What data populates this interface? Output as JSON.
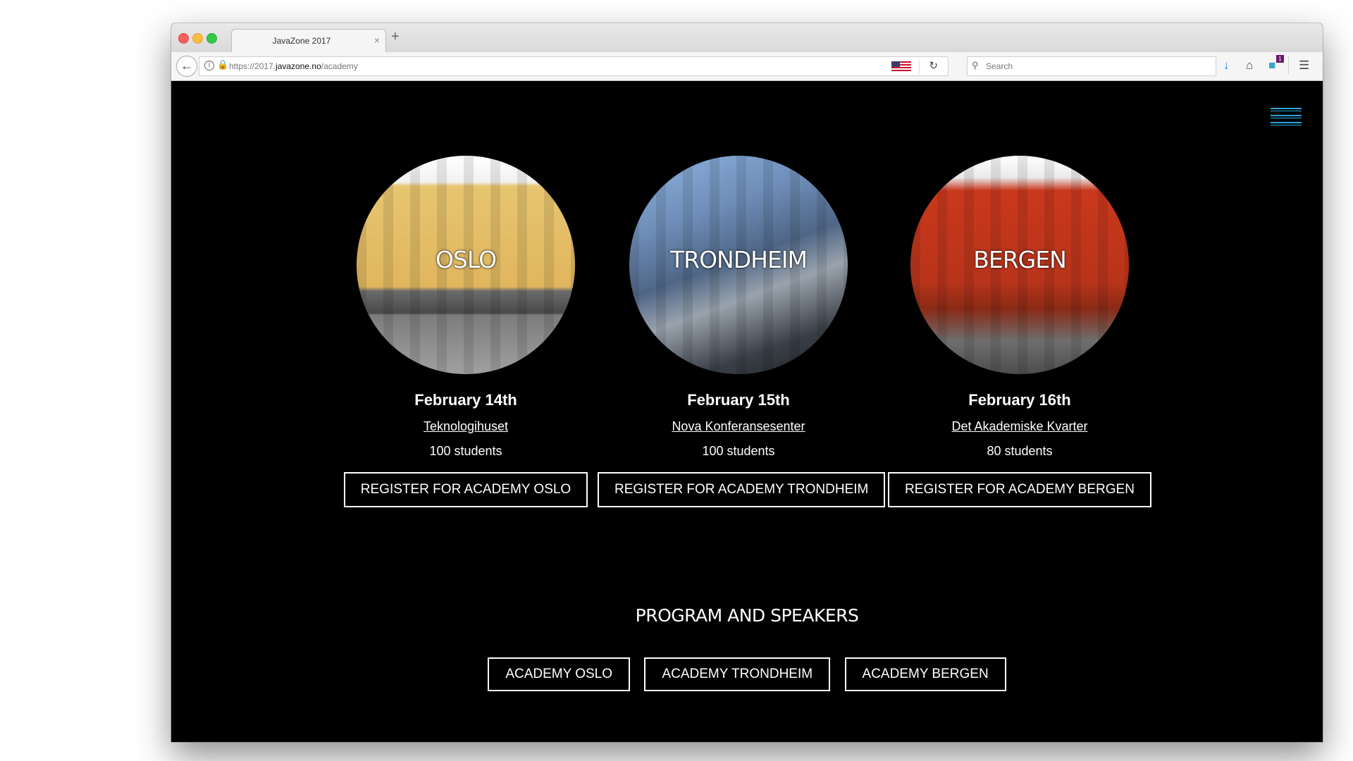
{
  "browser": {
    "tab_title": "JavaZone 2017",
    "tab_close": "×",
    "new_tab": "+",
    "url_prefix": "https://2017.",
    "url_host": "javazone.no",
    "url_path": "/academy",
    "search_placeholder": "Search",
    "notification_count": "1"
  },
  "venues": [
    {
      "city": "OSLO",
      "date": "February 14th",
      "place": "Teknologihuset",
      "students": "100 students",
      "register_label": "REGISTER FOR ACADEMY OSLO"
    },
    {
      "city": "TRONDHEIM",
      "date": "February 15th",
      "place": "Nova Konferansesenter",
      "students": "100 students",
      "register_label": "REGISTER FOR ACADEMY TRONDHEIM"
    },
    {
      "city": "BERGEN",
      "date": "February 16th",
      "place": "Det Akademiske Kvarter",
      "students": "80 students",
      "register_label": "REGISTER FOR ACADEMY BERGEN"
    }
  ],
  "program": {
    "title": "PROGRAM AND SPEAKERS",
    "buttons": [
      "ACADEMY OSLO",
      "ACADEMY TRONDHEIM",
      "ACADEMY BERGEN"
    ]
  },
  "colors": {
    "accent": "#29a7df",
    "page_bg": "#000000"
  }
}
